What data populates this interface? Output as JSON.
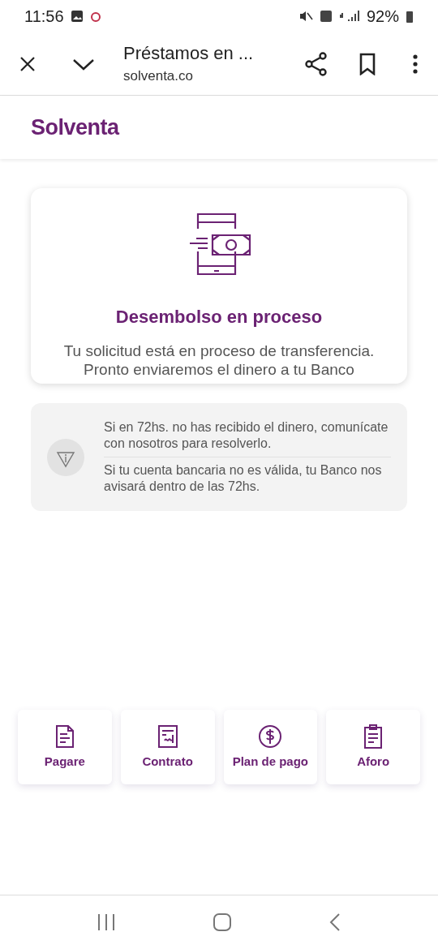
{
  "status_bar": {
    "time": "11:56",
    "battery": "92%"
  },
  "browser": {
    "title": "Préstamos en ...",
    "url": "solventa.co"
  },
  "header": {
    "logo": "Solventa"
  },
  "status_card": {
    "title": "Desembolso en proceso",
    "lines": [
      "Tu solicitud está en proceso de transferencia.",
      "Pronto enviaremos el dinero a tu Banco"
    ]
  },
  "notice": {
    "items": [
      "Si en 72hs. no has recibido el dinero, comunícate con nosotros para resolverlo.",
      "Si tu cuenta bancaria no es válida, tu Banco nos avisará dentro de las 72hs."
    ]
  },
  "actions": [
    {
      "label": "Pagare",
      "kind": "document"
    },
    {
      "label": "Contrato",
      "kind": "contract"
    },
    {
      "label": "Plan de pago",
      "kind": "dollar"
    },
    {
      "label": "Aforo",
      "kind": "clipboard"
    }
  ]
}
